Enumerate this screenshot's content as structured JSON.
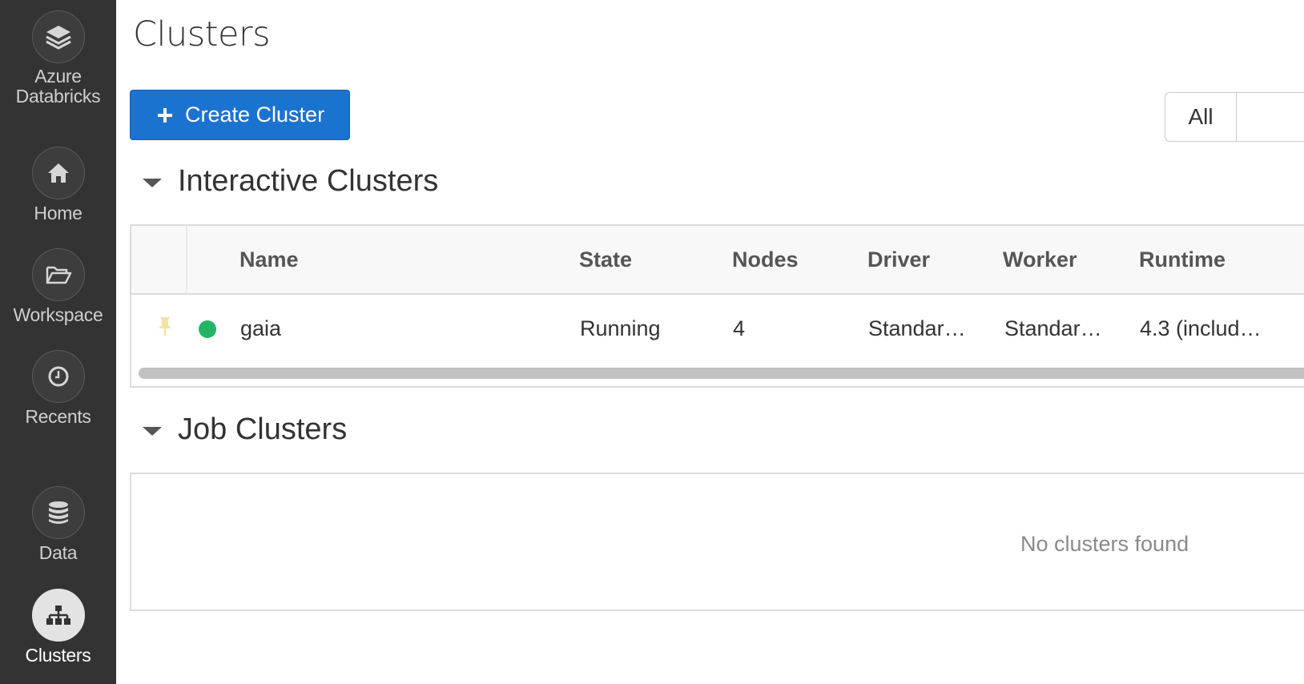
{
  "sidebar": {
    "brand_label_line1": "Azure",
    "brand_label_line2": "Databricks",
    "items": [
      {
        "label": "Home",
        "icon": "home-icon"
      },
      {
        "label": "Workspace",
        "icon": "folder-icon"
      },
      {
        "label": "Recents",
        "icon": "clock-icon"
      },
      {
        "label": "Data",
        "icon": "database-icon"
      },
      {
        "label": "Clusters",
        "icon": "sitemap-icon",
        "active": true
      }
    ]
  },
  "page": {
    "title": "Clusters",
    "create_button_label": "Create Cluster",
    "filter_all_label": "All"
  },
  "interactive": {
    "section_title": "Interactive Clusters",
    "columns": [
      "Name",
      "State",
      "Nodes",
      "Driver",
      "Worker",
      "Runtime"
    ],
    "rows": [
      {
        "name": "gaia",
        "state": "Running",
        "nodes": "4",
        "driver": "Standar…",
        "worker": "Standar…",
        "runtime": "4.3 (includ…",
        "status_color": "#22b566"
      }
    ]
  },
  "job": {
    "section_title": "Job Clusters",
    "empty_text": "No clusters found"
  },
  "colors": {
    "sidebar_bg": "#333333",
    "accent": "#1b73d0",
    "running": "#22b566"
  }
}
